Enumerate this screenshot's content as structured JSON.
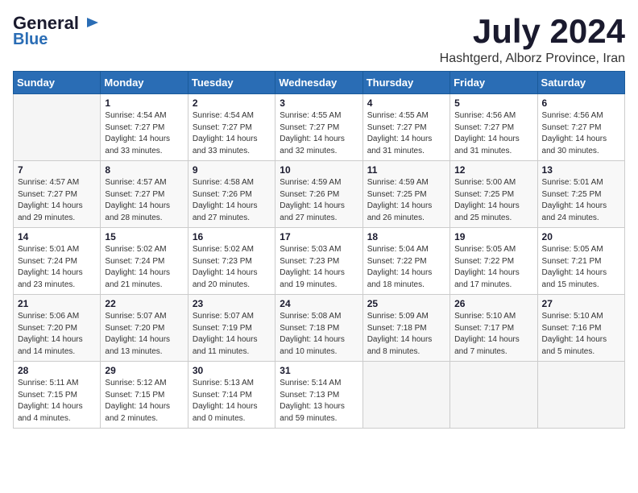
{
  "header": {
    "logo_general": "General",
    "logo_blue": "Blue",
    "month": "July 2024",
    "location": "Hashtgerd, Alborz Province, Iran"
  },
  "weekdays": [
    "Sunday",
    "Monday",
    "Tuesday",
    "Wednesday",
    "Thursday",
    "Friday",
    "Saturday"
  ],
  "weeks": [
    [
      {
        "day": "",
        "info": ""
      },
      {
        "day": "1",
        "info": "Sunrise: 4:54 AM\nSunset: 7:27 PM\nDaylight: 14 hours\nand 33 minutes."
      },
      {
        "day": "2",
        "info": "Sunrise: 4:54 AM\nSunset: 7:27 PM\nDaylight: 14 hours\nand 33 minutes."
      },
      {
        "day": "3",
        "info": "Sunrise: 4:55 AM\nSunset: 7:27 PM\nDaylight: 14 hours\nand 32 minutes."
      },
      {
        "day": "4",
        "info": "Sunrise: 4:55 AM\nSunset: 7:27 PM\nDaylight: 14 hours\nand 31 minutes."
      },
      {
        "day": "5",
        "info": "Sunrise: 4:56 AM\nSunset: 7:27 PM\nDaylight: 14 hours\nand 31 minutes."
      },
      {
        "day": "6",
        "info": "Sunrise: 4:56 AM\nSunset: 7:27 PM\nDaylight: 14 hours\nand 30 minutes."
      }
    ],
    [
      {
        "day": "7",
        "info": "Sunrise: 4:57 AM\nSunset: 7:27 PM\nDaylight: 14 hours\nand 29 minutes."
      },
      {
        "day": "8",
        "info": "Sunrise: 4:57 AM\nSunset: 7:27 PM\nDaylight: 14 hours\nand 28 minutes."
      },
      {
        "day": "9",
        "info": "Sunrise: 4:58 AM\nSunset: 7:26 PM\nDaylight: 14 hours\nand 27 minutes."
      },
      {
        "day": "10",
        "info": "Sunrise: 4:59 AM\nSunset: 7:26 PM\nDaylight: 14 hours\nand 27 minutes."
      },
      {
        "day": "11",
        "info": "Sunrise: 4:59 AM\nSunset: 7:25 PM\nDaylight: 14 hours\nand 26 minutes."
      },
      {
        "day": "12",
        "info": "Sunrise: 5:00 AM\nSunset: 7:25 PM\nDaylight: 14 hours\nand 25 minutes."
      },
      {
        "day": "13",
        "info": "Sunrise: 5:01 AM\nSunset: 7:25 PM\nDaylight: 14 hours\nand 24 minutes."
      }
    ],
    [
      {
        "day": "14",
        "info": "Sunrise: 5:01 AM\nSunset: 7:24 PM\nDaylight: 14 hours\nand 23 minutes."
      },
      {
        "day": "15",
        "info": "Sunrise: 5:02 AM\nSunset: 7:24 PM\nDaylight: 14 hours\nand 21 minutes."
      },
      {
        "day": "16",
        "info": "Sunrise: 5:02 AM\nSunset: 7:23 PM\nDaylight: 14 hours\nand 20 minutes."
      },
      {
        "day": "17",
        "info": "Sunrise: 5:03 AM\nSunset: 7:23 PM\nDaylight: 14 hours\nand 19 minutes."
      },
      {
        "day": "18",
        "info": "Sunrise: 5:04 AM\nSunset: 7:22 PM\nDaylight: 14 hours\nand 18 minutes."
      },
      {
        "day": "19",
        "info": "Sunrise: 5:05 AM\nSunset: 7:22 PM\nDaylight: 14 hours\nand 17 minutes."
      },
      {
        "day": "20",
        "info": "Sunrise: 5:05 AM\nSunset: 7:21 PM\nDaylight: 14 hours\nand 15 minutes."
      }
    ],
    [
      {
        "day": "21",
        "info": "Sunrise: 5:06 AM\nSunset: 7:20 PM\nDaylight: 14 hours\nand 14 minutes."
      },
      {
        "day": "22",
        "info": "Sunrise: 5:07 AM\nSunset: 7:20 PM\nDaylight: 14 hours\nand 13 minutes."
      },
      {
        "day": "23",
        "info": "Sunrise: 5:07 AM\nSunset: 7:19 PM\nDaylight: 14 hours\nand 11 minutes."
      },
      {
        "day": "24",
        "info": "Sunrise: 5:08 AM\nSunset: 7:18 PM\nDaylight: 14 hours\nand 10 minutes."
      },
      {
        "day": "25",
        "info": "Sunrise: 5:09 AM\nSunset: 7:18 PM\nDaylight: 14 hours\nand 8 minutes."
      },
      {
        "day": "26",
        "info": "Sunrise: 5:10 AM\nSunset: 7:17 PM\nDaylight: 14 hours\nand 7 minutes."
      },
      {
        "day": "27",
        "info": "Sunrise: 5:10 AM\nSunset: 7:16 PM\nDaylight: 14 hours\nand 5 minutes."
      }
    ],
    [
      {
        "day": "28",
        "info": "Sunrise: 5:11 AM\nSunset: 7:15 PM\nDaylight: 14 hours\nand 4 minutes."
      },
      {
        "day": "29",
        "info": "Sunrise: 5:12 AM\nSunset: 7:15 PM\nDaylight: 14 hours\nand 2 minutes."
      },
      {
        "day": "30",
        "info": "Sunrise: 5:13 AM\nSunset: 7:14 PM\nDaylight: 14 hours\nand 0 minutes."
      },
      {
        "day": "31",
        "info": "Sunrise: 5:14 AM\nSunset: 7:13 PM\nDaylight: 13 hours\nand 59 minutes."
      },
      {
        "day": "",
        "info": ""
      },
      {
        "day": "",
        "info": ""
      },
      {
        "day": "",
        "info": ""
      }
    ]
  ]
}
